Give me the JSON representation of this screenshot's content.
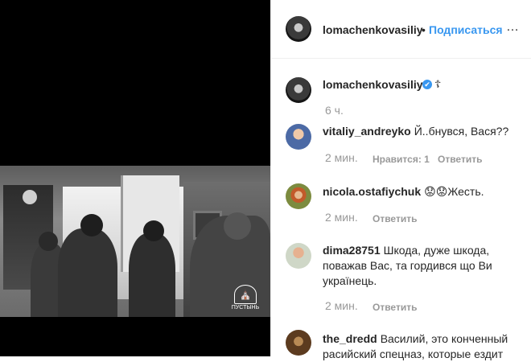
{
  "post": {
    "owner_username": "lomachenkovasiliy",
    "follow_separator": "•",
    "follow_label": "Подписаться",
    "more_label": "…",
    "verified_mark": "✔",
    "caption_emoji": "☦",
    "posted_ago": "6 ч.",
    "video_watermark": "ПУСТЫНЬ"
  },
  "comments": [
    {
      "username": "vitaliy_andreyko",
      "text": "Й..бнувся, Вася??",
      "time": "2 мин.",
      "likes": "Нравится: 1",
      "reply": "Ответить"
    },
    {
      "username": "nicola.ostafiychuk",
      "emoji": [
        "😟",
        "😟"
      ],
      "text": "Жесть.",
      "time": "2 мин.",
      "reply": "Ответить"
    },
    {
      "username": "dima28751",
      "text": "Шкода, дуже шкода, поважав Вас, та гордився що Ви українець.",
      "time": "2 мин.",
      "reply": "Ответить"
    },
    {
      "username": "the_dredd",
      "text": "Василий, это конченный расийский спецназ, которые ездит"
    }
  ],
  "colors": {
    "link": "#3897f0",
    "meta": "#999999",
    "text": "#262626"
  }
}
